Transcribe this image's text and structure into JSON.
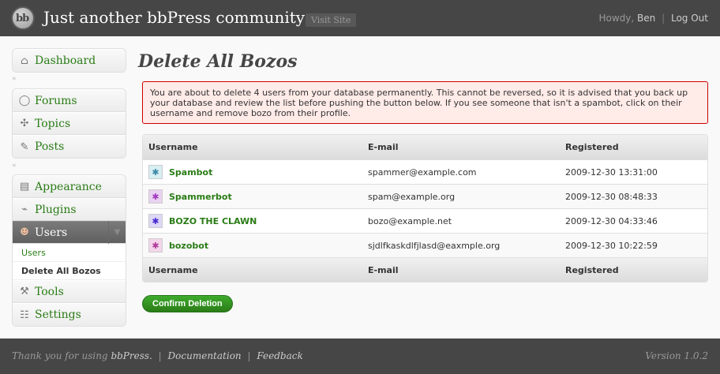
{
  "header": {
    "logo_text": "bb",
    "site_title": "Just another bbPress community",
    "visit_site": "Visit Site",
    "howdy": "Howdy,",
    "user": "Ben",
    "logout": "Log Out"
  },
  "sidebar": {
    "dashboard": "Dashboard",
    "forums": "Forums",
    "topics": "Topics",
    "posts": "Posts",
    "appearance": "Appearance",
    "plugins": "Plugins",
    "users": "Users",
    "sub_users": "Users",
    "sub_delete_bozos": "Delete All Bozos",
    "tools": "Tools",
    "settings": "Settings"
  },
  "main": {
    "title": "Delete All Bozos",
    "notice": "You are about to delete 4 users from your database permanently. This cannot be reversed, so it is advised that you back up your database and review the list before pushing the button below. If you see someone that isn't a spambot, click on their username and remove bozo from their profile.",
    "table": {
      "headers": [
        "Username",
        "E-mail",
        "Registered"
      ],
      "rows": [
        {
          "username": "Spambot",
          "email": "spammer@example.com",
          "registered": "2009-12-30 13:31:00"
        },
        {
          "username": "Spammerbot",
          "email": "spam@example.org",
          "registered": "2009-12-30 08:48:33"
        },
        {
          "username": "BOZO THE CLAWN",
          "email": "bozo@example.net",
          "registered": "2009-12-30 04:33:46"
        },
        {
          "username": "bozobot",
          "email": "sjdlfkaskdlfjlasd@eaxmple.org",
          "registered": "2009-12-30 10:22:59"
        }
      ]
    },
    "confirm_button": "Confirm Deletion"
  },
  "footer": {
    "thanks": "Thank you for using",
    "bbpress": "bbPress.",
    "documentation": "Documentation",
    "feedback": "Feedback",
    "version": "Version 1.0.2"
  },
  "colors": {
    "header_bg": "#464646",
    "link_green": "#2a7c16",
    "notice_bg": "#ffebe8",
    "notice_border": "#cc0000",
    "button_green": "#2a7c16"
  },
  "icons": {
    "logo": "bbpress-logo",
    "dashboard": "home-icon",
    "forums": "speech-bubble-icon",
    "topics": "tags-icon",
    "posts": "pin-icon",
    "appearance": "layout-icon",
    "plugins": "plug-icon",
    "users": "users-icon",
    "tools": "tools-icon",
    "settings": "settings-icon",
    "collapse": "chevron-down-icon"
  }
}
